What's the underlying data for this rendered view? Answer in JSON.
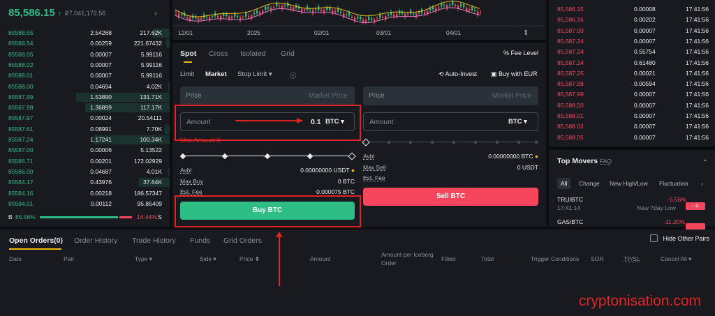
{
  "header": {
    "last_price": "85,586.15",
    "arrow": "↑",
    "price_local": "₽7,041,172.56",
    "more": "›"
  },
  "order_book": {
    "rows": [
      [
        "85588.55",
        "2.54268",
        "217.62K"
      ],
      [
        "85588.54",
        "0.00259",
        "221.67432"
      ],
      [
        "85588.05",
        "0.00007",
        "5.99116"
      ],
      [
        "85588.02",
        "0.00007",
        "5.99116"
      ],
      [
        "85588.01",
        "0.00007",
        "5.99116"
      ],
      [
        "85588.00",
        "0.04694",
        "4.02K"
      ],
      [
        "85587.99",
        "1.53890",
        "131.71K"
      ],
      [
        "85587.98",
        "1.36899",
        "117.17K"
      ],
      [
        "85587.97",
        "0.00024",
        "20.54111"
      ],
      [
        "85587.61",
        "0.08991",
        "7.70K"
      ],
      [
        "85587.24",
        "1.17241",
        "100.34K"
      ],
      [
        "85587.00",
        "0.00006",
        "5.13522"
      ],
      [
        "85586.71",
        "0.00201",
        "172.02929"
      ],
      [
        "85586.00",
        "0.04687",
        "4.01K"
      ],
      [
        "85584.17",
        "0.43976",
        "37.64K"
      ],
      [
        "85584.16",
        "0.00218",
        "186.57347"
      ],
      [
        "85584.01",
        "0.00112",
        "95.85409"
      ]
    ],
    "depth": [
      0.1,
      0.02,
      0,
      0,
      0,
      0.01,
      0.55,
      0.5,
      0,
      0.03,
      0.45,
      0,
      0,
      0.01,
      0.18,
      0,
      0
    ],
    "buy_label": "B",
    "buy_pct": "85.56%",
    "sell_pct": "14.44%",
    "sell_label": "S"
  },
  "chart_axis": {
    "ticks": [
      "12/01",
      "2025",
      "02/01",
      "03/01",
      "04/01"
    ],
    "fullscreen_icon": "expand-icon"
  },
  "trade": {
    "tabs": [
      "Spot",
      "Cross",
      "Isolated",
      "Grid"
    ],
    "fee_level": "Fee Level",
    "order_types": [
      "Limit",
      "Market",
      "Stop Limit ▾"
    ],
    "info_icon": "ⓘ",
    "auto_invest": "Auto-Invest",
    "buy_with": "Buy with EUR",
    "buy": {
      "price_label": "Price",
      "price_placeholder": "Market Price",
      "amount_label": "Amount",
      "amount_value": "0.1",
      "amount_unit": "BTC ▾",
      "max_amount": "Max Amount 0",
      "avbl_label": "Avbl",
      "avbl_value": "0.00000000 USDT",
      "max_label": "Max Buy",
      "max_value": "0 BTC",
      "fee_label": "Est. Fee",
      "fee_value": "0.000075 BTC",
      "button": "Buy BTC"
    },
    "sell": {
      "price_label": "Price",
      "price_placeholder": "Market Price",
      "amount_label": "Amount",
      "amount_unit": "BTC ▾",
      "avbl_label": "Avbl",
      "avbl_value": "0.00000000 BTC",
      "max_label": "Max Sell",
      "max_value": "0 USDT",
      "fee_label": "Est. Fee",
      "button": "Sell BTC"
    }
  },
  "trades": {
    "rows": [
      [
        "85,586.15",
        "0.00008",
        "17:41:56",
        "red"
      ],
      [
        "85,586.16",
        "0.00202",
        "17:41:56",
        "red"
      ],
      [
        "85,587.00",
        "0.00007",
        "17:41:56",
        "red"
      ],
      [
        "85,587.24",
        "0.00007",
        "17:41:56",
        "red"
      ],
      [
        "85,587.24",
        "0.55754",
        "17:41:56",
        "red"
      ],
      [
        "85,587.24",
        "0.61480",
        "17:41:56",
        "red"
      ],
      [
        "85,587.25",
        "0.00021",
        "17:41:56",
        "red"
      ],
      [
        "85,587.98",
        "0.00594",
        "17:41:56",
        "red"
      ],
      [
        "85,587.99",
        "0.00007",
        "17:41:56",
        "red"
      ],
      [
        "85,588.00",
        "0.00007",
        "17:41:56",
        "red"
      ],
      [
        "85,588.01",
        "0.00007",
        "17:41:56",
        "red"
      ],
      [
        "85,588.02",
        "0.00007",
        "17:41:56",
        "red"
      ],
      [
        "85,588.05",
        "0.00007",
        "17:41:56",
        "red"
      ]
    ]
  },
  "movers": {
    "title": "Top Movers",
    "faq": "FAQ",
    "tabs": [
      "All",
      "Change",
      "New High/Low",
      "Fluctuation",
      "›"
    ],
    "items": [
      {
        "pair": "TRU/BTC",
        "time": "17:41:14",
        "change": "-5.56%",
        "note": "New 7day Low"
      },
      {
        "pair": "GAS/BTC",
        "time": "",
        "change": "-11.20%",
        "note": ""
      }
    ]
  },
  "orders": {
    "tabs": [
      "Open Orders(0)",
      "Order History",
      "Trade History",
      "Funds",
      "Grid Orders"
    ],
    "hide_other_pairs": "Hide Other Pairs",
    "columns": [
      "Date",
      "Pair",
      "Type ▾",
      "Side ▾",
      "Price ⬍",
      "Amount",
      "Amount per Iceberg Order",
      "Filled",
      "Total",
      "Trigger Conditions",
      "SOR",
      "TP/SL",
      "Cancel All ▾"
    ]
  },
  "watermark": "cryptonisation.com",
  "colors": {
    "green": "#2ebd85",
    "red": "#f6465d",
    "accent": "#f0b90b",
    "annotation": "#e02424"
  }
}
